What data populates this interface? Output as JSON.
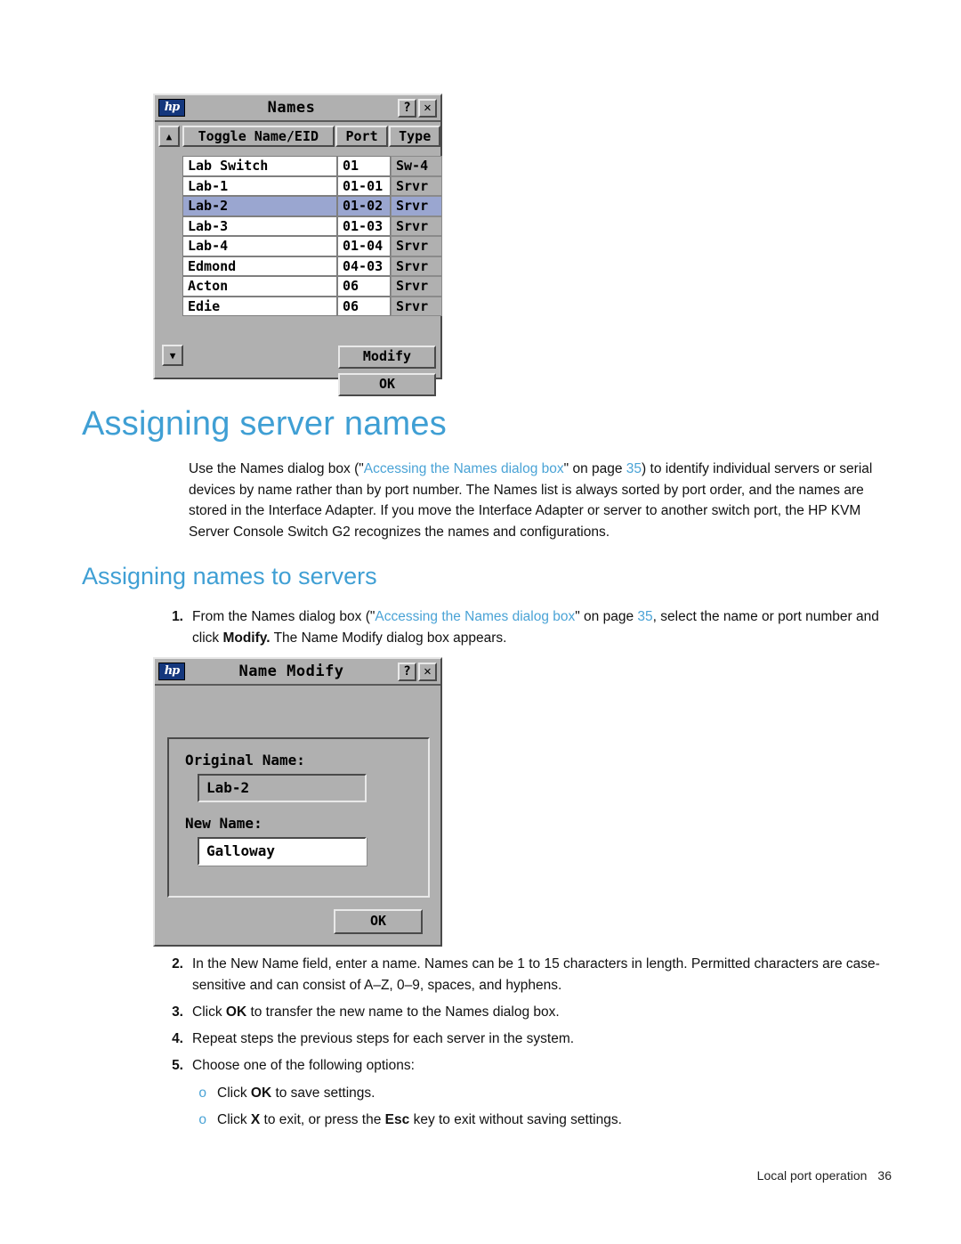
{
  "names_dialog": {
    "title": "Names",
    "help_button": "?",
    "close_button": "✕",
    "scroll_up": "▲",
    "scroll_down": "▼",
    "headers": {
      "toggle": "Toggle Name/EID",
      "port": "Port",
      "type": "Type"
    },
    "rows": [
      {
        "name": "Lab Switch",
        "port": "01",
        "type": "Sw-4",
        "selected": false
      },
      {
        "name": "Lab-1",
        "port": "01-01",
        "type": "Srvr",
        "selected": false
      },
      {
        "name": "Lab-2",
        "port": "01-02",
        "type": "Srvr",
        "selected": true
      },
      {
        "name": "Lab-3",
        "port": "01-03",
        "type": "Srvr",
        "selected": false
      },
      {
        "name": "Lab-4",
        "port": "01-04",
        "type": "Srvr",
        "selected": false
      },
      {
        "name": "Edmond",
        "port": "04-03",
        "type": "Srvr",
        "selected": false
      },
      {
        "name": "Acton",
        "port": "06",
        "type": "Srvr",
        "selected": false
      },
      {
        "name": "Edie",
        "port": "06",
        "type": "Srvr",
        "selected": false
      }
    ],
    "modify_button": "Modify",
    "ok_button": "OK"
  },
  "modify_dialog": {
    "title": "Name Modify",
    "help_button": "?",
    "close_button": "✕",
    "original_name_label": "Original Name:",
    "original_name_value": "Lab-2",
    "new_name_label": "New Name:",
    "new_name_value": "Galloway",
    "ok_button": "OK"
  },
  "content": {
    "page_title": "Assigning server names",
    "intro": {
      "part1": "Use the Names dialog box (\"",
      "link1": "Accessing the Names dialog box",
      "part2": "\" on page ",
      "page_ref": "35",
      "part3": ") to identify individual servers or serial devices by name rather than by port number. The Names list is always sorted by port order, and the names are stored in the Interface Adapter. If you move the Interface Adapter or server to another switch port, the HP KVM Server Console Switch G2 recognizes the names and configurations."
    },
    "section_title": "Assigning names to servers",
    "steps": [
      {
        "number": "1.",
        "part1": "From the Names dialog box (\"",
        "link": "Accessing the Names dialog box",
        "part2": "\" on page ",
        "page_ref": "35",
        "part3": ", select the name or port number and click ",
        "bold": "Modify.",
        "part4": " The Name Modify dialog box appears."
      },
      {
        "number": "2.",
        "text": "In the New Name field, enter a name. Names can be 1 to 15 characters in length. Permitted characters are case-sensitive and can consist of A–Z, 0–9, spaces, and hyphens."
      },
      {
        "number": "3.",
        "part1": "Click ",
        "bold": "OK",
        "part2": " to transfer the new name to the Names dialog box."
      },
      {
        "number": "4.",
        "text": "Repeat steps the previous steps for each server in the system."
      },
      {
        "number": "5.",
        "text": "Choose one of the following options:"
      }
    ],
    "sub_items": [
      {
        "bullet": "o",
        "part1": "Click ",
        "bold": "OK",
        "part2": " to save settings."
      },
      {
        "bullet": "o",
        "part1": "Click ",
        "bold": "X",
        "part2": " to exit, or press the ",
        "bold2": "Esc",
        "part3": " key to exit without saving settings."
      }
    ],
    "footer_text": "Local port operation",
    "footer_page": "36"
  }
}
